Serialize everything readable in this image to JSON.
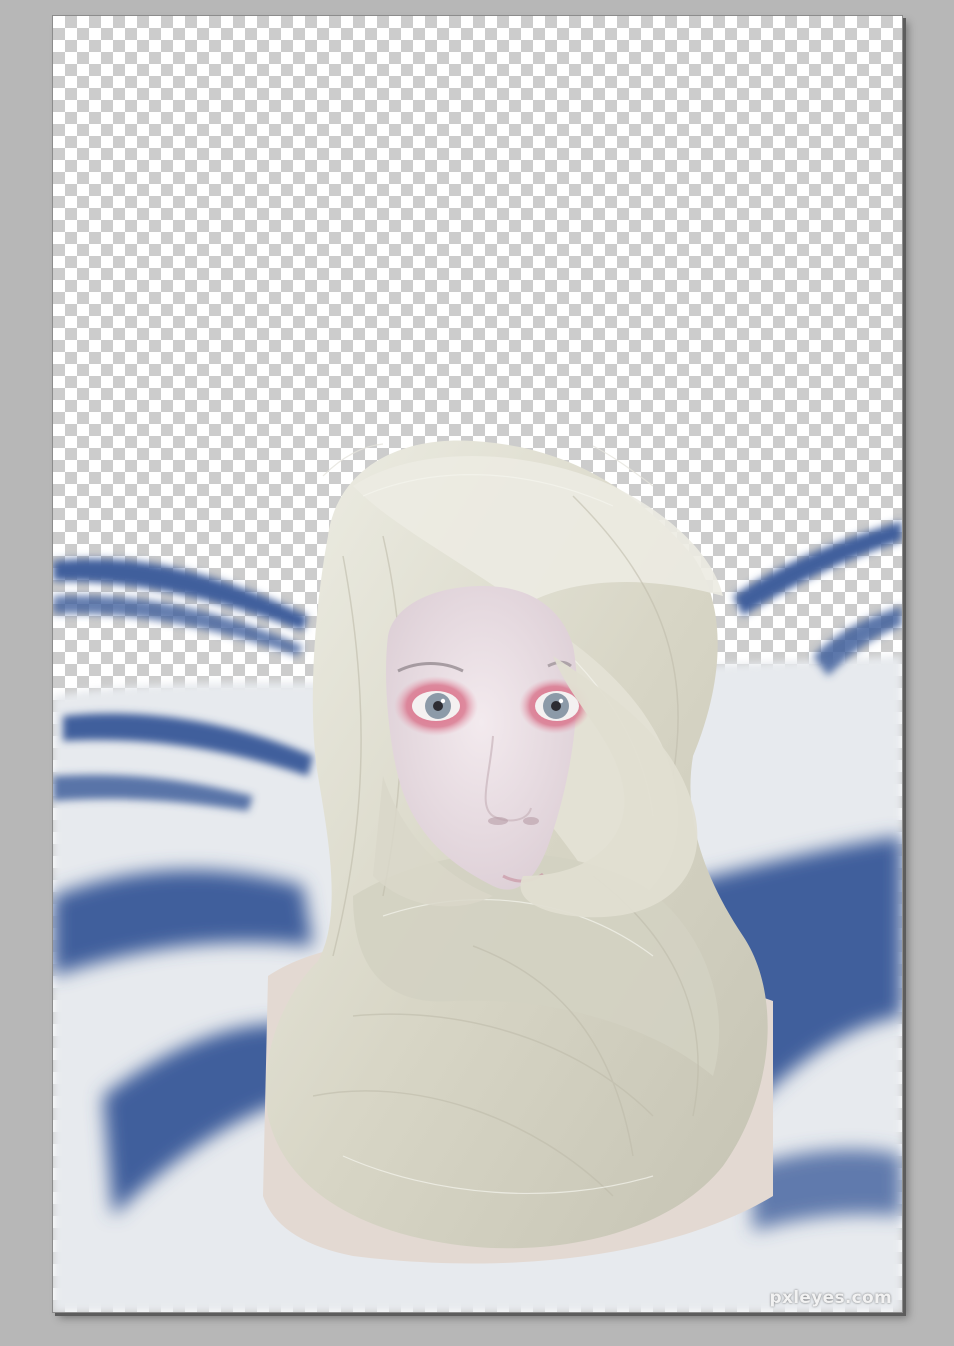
{
  "watermark": {
    "text": "pxleyes.com"
  },
  "document": {
    "transparency_pattern": "checkerboard",
    "colors": {
      "background_white": "#e6e9ec",
      "brush_blue": "#3f5f9c",
      "hair": "#dddccf",
      "skin": "#eae0e4",
      "eye_makeup": "#d5607c",
      "iris": "#8897a5"
    }
  }
}
